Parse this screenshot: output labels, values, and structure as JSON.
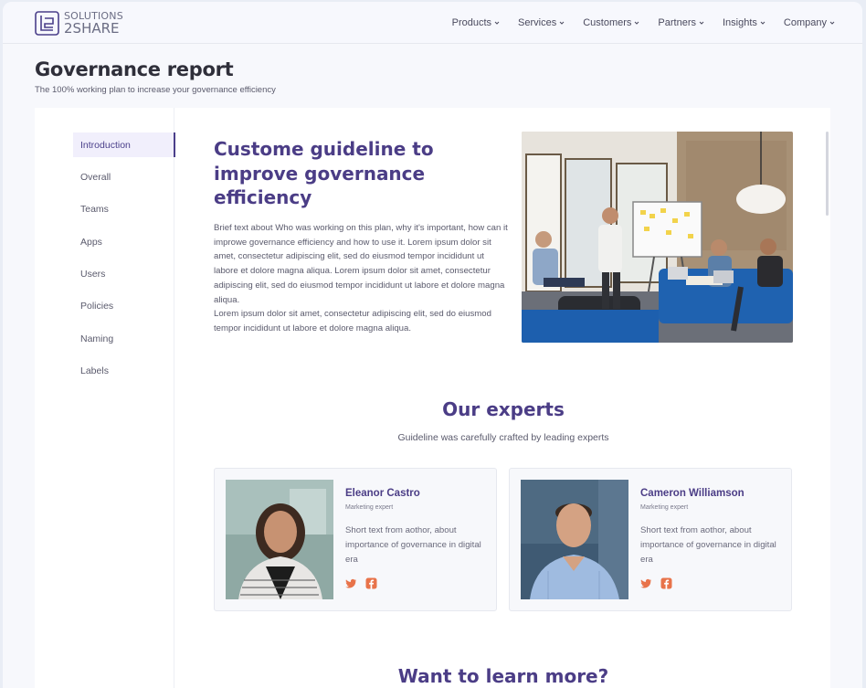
{
  "brand": {
    "line1": "SOLUTIONS",
    "line2": "2SHARE"
  },
  "nav": {
    "items": [
      "Products",
      "Services",
      "Customers",
      "Partners",
      "Insights",
      "Company"
    ]
  },
  "header": {
    "title": "Governance report",
    "subtitle": "The 100% working plan to increase your governance efficiency"
  },
  "sidebar": {
    "items": [
      {
        "label": "Introduction",
        "active": true
      },
      {
        "label": "Overall"
      },
      {
        "label": "Teams"
      },
      {
        "label": "Apps"
      },
      {
        "label": "Users"
      },
      {
        "label": "Policies"
      },
      {
        "label": "Naming"
      },
      {
        "label": "Labels"
      }
    ]
  },
  "hero": {
    "title": "Custome guideline to improve governance efficiency",
    "paragraph1": "Brief text about Who was working on this plan, why it's important, how can it improwe governance efficiency and how to use it. Lorem ipsum dolor sit amet, consectetur adipiscing elit, sed do eiusmod tempor incididunt ut labore et dolore magna aliqua. Lorem ipsum dolor sit amet, consectetur adipiscing elit, sed do eiusmod tempor incididunt ut labore et dolore magna aliqua.",
    "paragraph2": "Lorem ipsum dolor sit amet, consectetur adipiscing elit, sed do eiusmod tempor incididunt ut labore et dolore magna aliqua."
  },
  "experts": {
    "title": "Our experts",
    "subtitle": "Guideline was carefully crafted by leading experts",
    "people": [
      {
        "name": "Eleanor Castro",
        "role": "Marketing expert",
        "bio": "Short text from aothor, about importance of governance in digital era"
      },
      {
        "name": "Cameron Williamson",
        "role": "Marketing expert",
        "bio": "Short text from aothor, about importance of governance in digital era"
      }
    ]
  },
  "more": {
    "title": "Want to learn more?"
  },
  "colors": {
    "accent": "#4b3d86",
    "social": "#e8734a",
    "background": "#f7f8fc"
  }
}
